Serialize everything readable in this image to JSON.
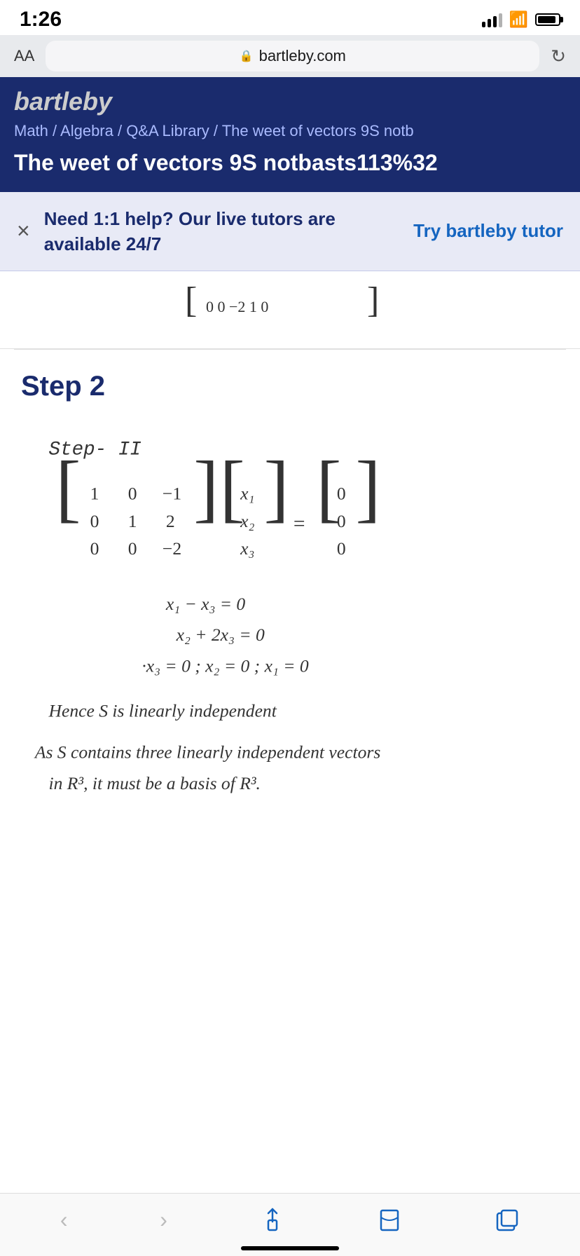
{
  "status_bar": {
    "time": "1:26",
    "signal": "signal",
    "wifi": "wifi",
    "battery": "battery"
  },
  "browser": {
    "aa_label": "AA",
    "url": "bartleby.com",
    "lock_icon": "🔒",
    "refresh_icon": "↻"
  },
  "site_header": {
    "logo_text": "bartleby",
    "breadcrumb": "Math / Algebra / Q&A Library / The weet of vectors 9S notb",
    "page_title": "The weet of vectors 9S notbasts113%32"
  },
  "tutor_banner": {
    "close_icon": "×",
    "main_text": "Need 1:1 help? Our live tutors are available 24/7",
    "cta_text": "Try bartleby tutor"
  },
  "matrix_top": {
    "content": "[ 0   0   −2  1 0 ]"
  },
  "step2": {
    "title": "Step 2",
    "step_label": "Step- II"
  },
  "math_content": {
    "equation1": "x₁ − x₃ = 0",
    "equation2": "x₂ + 2x₃ = 0",
    "equation3": "·x₃ = 0 ;  x₂ = 0 ;  x₁ = 0",
    "conclusion1": "Hence S is linearly independent",
    "conclusion2": "As S contains three linearly independent vectors in R³, it must be a basis of R³."
  },
  "bottom_nav": {
    "back_label": "‹",
    "forward_label": "›",
    "share_label": "share",
    "bookmarks_label": "bookmarks",
    "tabs_label": "tabs"
  }
}
